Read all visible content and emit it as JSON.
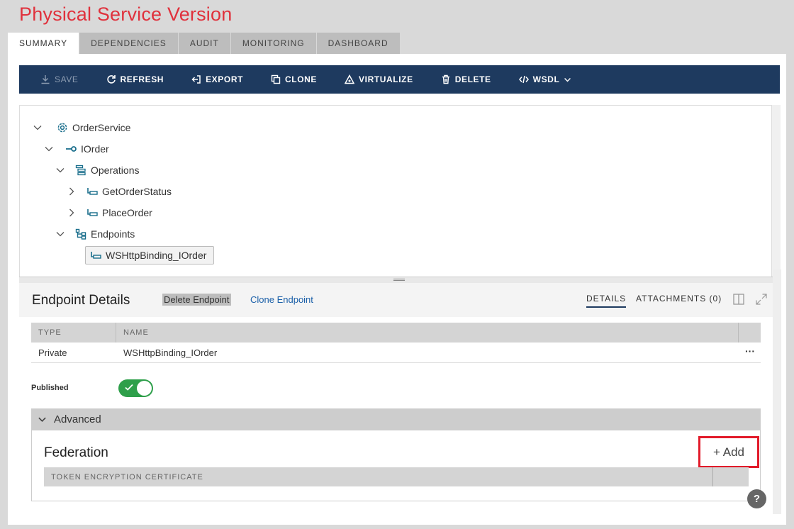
{
  "page": {
    "title": "Physical Service Version"
  },
  "tabs": [
    {
      "label": "SUMMARY",
      "active": true
    },
    {
      "label": "DEPENDENCIES"
    },
    {
      "label": "AUDIT"
    },
    {
      "label": "MONITORING"
    },
    {
      "label": "DASHBOARD"
    }
  ],
  "toolbar": {
    "save": "SAVE",
    "refresh": "REFRESH",
    "export": "EXPORT",
    "clone": "CLONE",
    "virtualize": "VIRTUALIZE",
    "delete": "DELETE",
    "wsdl": "WSDL"
  },
  "tree": {
    "service": "OrderService",
    "interface": "IOrder",
    "operations": "Operations",
    "op1": "GetOrderStatus",
    "op2": "PlaceOrder",
    "endpoints": "Endpoints",
    "endpoint1": "WSHttpBinding_IOrder"
  },
  "details": {
    "title": "Endpoint Details",
    "delete_endpoint": "Delete Endpoint",
    "clone_endpoint": "Clone Endpoint",
    "tab_details": "DETAILS",
    "tab_attachments": "ATTACHMENTS (0)"
  },
  "table": {
    "col_type": "TYPE",
    "col_name": "NAME",
    "row_type": "Private",
    "row_name": "WSHttpBinding_IOrder",
    "more": "···"
  },
  "published": {
    "label": "Published",
    "on": true
  },
  "advanced": {
    "label": "Advanced",
    "federation_title": "Federation",
    "add_label": "+ Add",
    "cert_col": "TOKEN ENCRYPTION CERTIFICATE"
  },
  "help": "?",
  "colors": {
    "title": "#e0313c",
    "toolbar": "#1e3a5f",
    "toggle": "#2e9f4a",
    "highlight": "#e21b2a",
    "link": "#1a5fa8",
    "icon": "#1a6e8c"
  }
}
